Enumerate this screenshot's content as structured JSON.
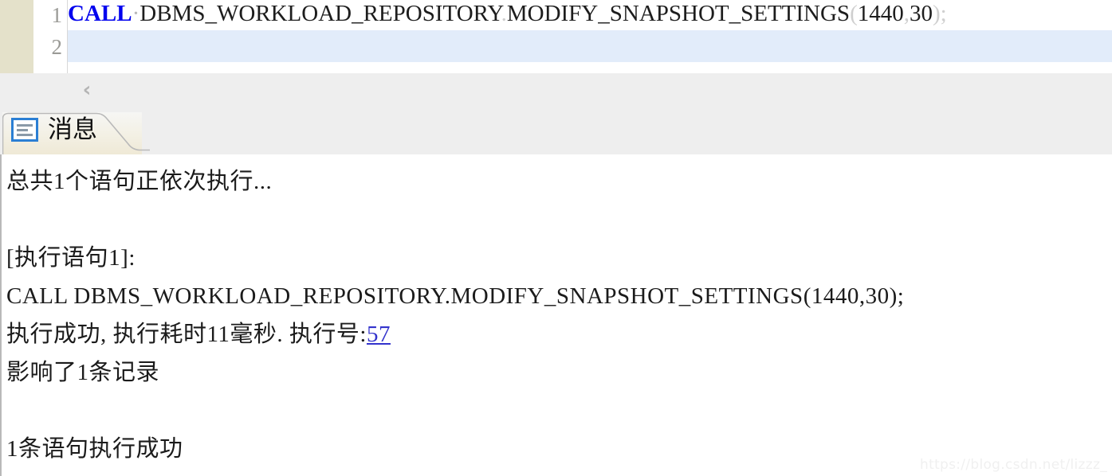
{
  "editor": {
    "line_numbers": [
      "1",
      "2"
    ],
    "line1": {
      "keyword": "CALL",
      "whitespace_dot": "·",
      "identifier": "DBMS_WORKLOAD_REPOSITORY",
      "dot": ".",
      "procedure": "MODIFY_SNAPSHOT_SETTINGS",
      "open_paren": "(",
      "arg1": "1440",
      "comma": ",",
      "arg2": "30",
      "close_paren": ")",
      "semicolon": ";"
    },
    "line2": ""
  },
  "toolbar": {
    "collapse_icon": "‹"
  },
  "tabs": [
    {
      "label": "消息",
      "icon": "message-lines-icon",
      "active": true
    }
  ],
  "message_panel": {
    "lines": [
      "总共1个语句正依次执行...",
      "",
      "[执行语句1]:",
      "CALL DBMS_WORKLOAD_REPOSITORY.MODIFY_SNAPSHOT_SETTINGS(1440,30);",
      "",
      "影响了1条记录",
      "",
      "1条语句执行成功"
    ],
    "exec_result_prefix": "执行成功, 执行耗时11毫秒. 执行号:",
    "exec_id": "57"
  },
  "watermark": "https://blog.csdn.net/lizzz_",
  "colors": {
    "keyword": "#0000ee",
    "link": "#3333cc",
    "tab_icon_border": "#2b7fd4",
    "bookmark_strip": "#e4e1ca",
    "current_line_highlight": "#e2ecfa",
    "toolbar_bg": "#eeeeee"
  }
}
